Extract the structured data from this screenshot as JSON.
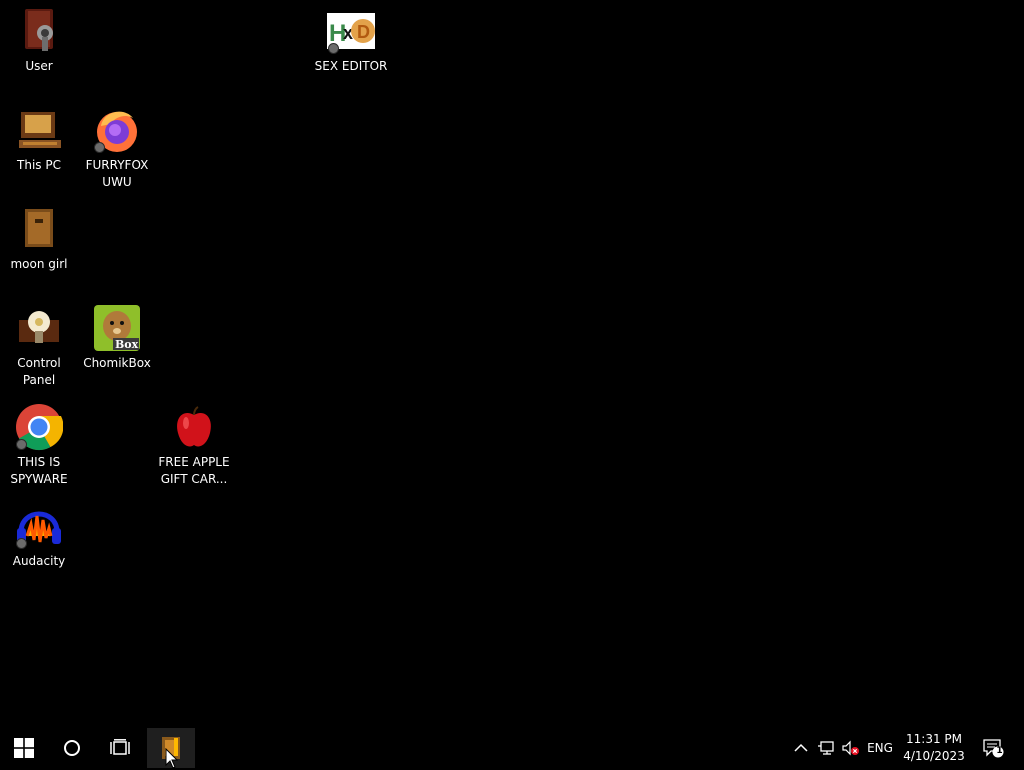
{
  "desktop": {
    "background": "#000000",
    "icons": [
      {
        "label": "User",
        "icon": "user-folder-icon"
      },
      {
        "label": "SEX EDITOR",
        "icon": "hxd-hex-editor-icon"
      },
      {
        "label": "This PC",
        "icon": "computer-icon"
      },
      {
        "label": "FURRYFOX UWU",
        "icon": "firefox-icon"
      },
      {
        "label": "moon girl",
        "icon": "wooden-box-icon"
      },
      {
        "label": "Control Panel",
        "icon": "lightbulb-icon"
      },
      {
        "label": "ChomikBox",
        "icon": "hamster-box-icon"
      },
      {
        "label": "THIS IS SPYWARE",
        "icon": "chrome-icon"
      },
      {
        "label": "FREE APPLE GIFT CAR...",
        "icon": "red-apple-icon"
      },
      {
        "label": "Audacity",
        "icon": "audacity-headphones-icon"
      }
    ]
  },
  "taskbar": {
    "start": "windows-logo-icon",
    "search": "cortana-circle-icon",
    "task_view": "task-view-icon",
    "pinned_app": "file-explorer-box-icon",
    "tray": {
      "language": "ENG",
      "time": "11:31 PM",
      "date": "4/10/2023",
      "notification_count": "1"
    }
  },
  "colors": {
    "taskbar_bg": "#000000",
    "text": "#ffffff",
    "chrome_red": "#db4437",
    "chrome_green": "#0f9d58",
    "chrome_yellow": "#f4b400",
    "chrome_blue": "#4285f4"
  }
}
